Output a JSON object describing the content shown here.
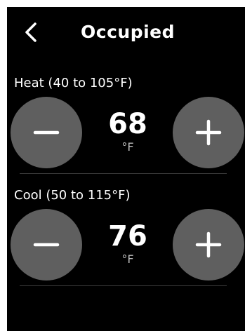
{
  "header": {
    "title": "Occupied",
    "back_icon": "chevron-left-icon"
  },
  "heat": {
    "range_label": "Heat (40 to 105°F)",
    "setpoint": "68",
    "unit": "°F",
    "decrease_icon": "minus-icon",
    "increase_icon": "plus-icon"
  },
  "cool": {
    "range_label": "Cool (50 to 115°F)",
    "setpoint": "76",
    "unit": "°F",
    "decrease_icon": "minus-icon",
    "increase_icon": "plus-icon"
  },
  "colors": {
    "background": "#000000",
    "button_fill": "#5f5f5f",
    "text": "#ffffff",
    "unit_text": "#bdbdbd",
    "divider": "#3a3a3a"
  }
}
